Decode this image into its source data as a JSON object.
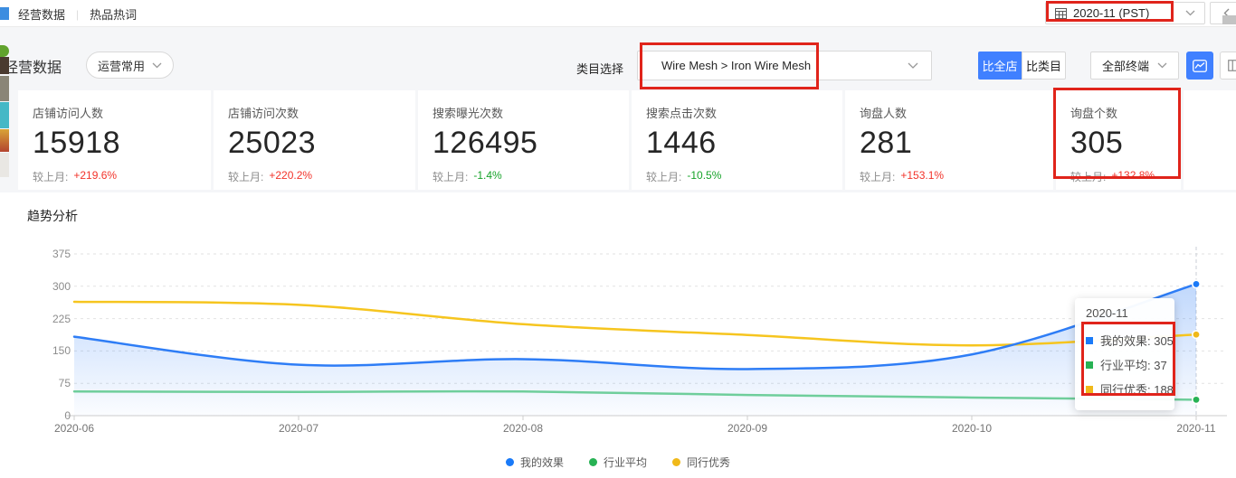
{
  "topbar": {
    "tabs": [
      {
        "label": "经营数据"
      },
      {
        "label": "热品热词"
      }
    ],
    "date_picker": {
      "value": "2020-11 (PST)"
    },
    "prev_button_label": "<"
  },
  "filters": {
    "section_title": "经营数据",
    "preset_select": {
      "value": "运营常用"
    },
    "category_label": "类目选择",
    "category_select": {
      "value": "Wire Mesh > Iron Wire Mesh"
    },
    "compare_buttons": [
      {
        "label": "比全店",
        "active": true
      },
      {
        "label": "比类目",
        "active": false
      }
    ],
    "terminal_select": {
      "value": "全部终端"
    }
  },
  "stats": {
    "compare_label": "较上月:",
    "cards": [
      {
        "label": "店铺访问人数",
        "value": "15918",
        "change": "+219.6%",
        "direction": "up"
      },
      {
        "label": "店铺访问次数",
        "value": "25023",
        "change": "+220.2%",
        "direction": "up"
      },
      {
        "label": "搜索曝光次数",
        "value": "126495",
        "change": "-1.4%",
        "direction": "down"
      },
      {
        "label": "搜索点击次数",
        "value": "1446",
        "change": "-10.5%",
        "direction": "down"
      },
      {
        "label": "询盘人数",
        "value": "281",
        "change": "+153.1%",
        "direction": "up"
      },
      {
        "label": "询盘个数",
        "value": "305",
        "change": "+132.8%",
        "direction": "up",
        "highlighted": true
      }
    ]
  },
  "trend": {
    "title": "趋势分析"
  },
  "chart_data": {
    "type": "line",
    "x": [
      "2020-06",
      "2020-07",
      "2020-08",
      "2020-09",
      "2020-10",
      "2020-11"
    ],
    "series": [
      {
        "name": "我的效果",
        "color": "#2e7df6",
        "marker_color": "#1a7af8",
        "area": true,
        "values": [
          183,
          118,
          131,
          108,
          142,
          305
        ]
      },
      {
        "name": "行业平均",
        "color": "#6fce9b",
        "marker_color": "#27b254",
        "values": [
          56,
          55,
          56,
          48,
          42,
          37
        ]
      },
      {
        "name": "同行优秀",
        "color": "#f6c51f",
        "marker_color": "#f0b91a",
        "values": [
          264,
          257,
          212,
          187,
          163,
          188
        ]
      }
    ],
    "ylim": [
      0,
      375
    ],
    "yticks": [
      0,
      75,
      150,
      225,
      300,
      375
    ],
    "grid": "dashed-horizontal",
    "legend_position": "bottom",
    "smooth": true,
    "hover_x": "2020-11",
    "tooltip": {
      "title": "2020-11",
      "items": [
        {
          "name": "我的效果",
          "value": 305,
          "color": "#1a7af8"
        },
        {
          "name": "行业平均",
          "value": 37,
          "color": "#27b254"
        },
        {
          "name": "同行优秀",
          "value": 188,
          "color": "#f0b91a"
        }
      ]
    }
  },
  "icons": {
    "calendar-icon": "▦",
    "chevron-down-icon": "∨",
    "chevron-left-icon": "<",
    "line-chart-icon": "〽",
    "columns-icon": "▥"
  },
  "annotations": {
    "color": "#e0241b"
  }
}
